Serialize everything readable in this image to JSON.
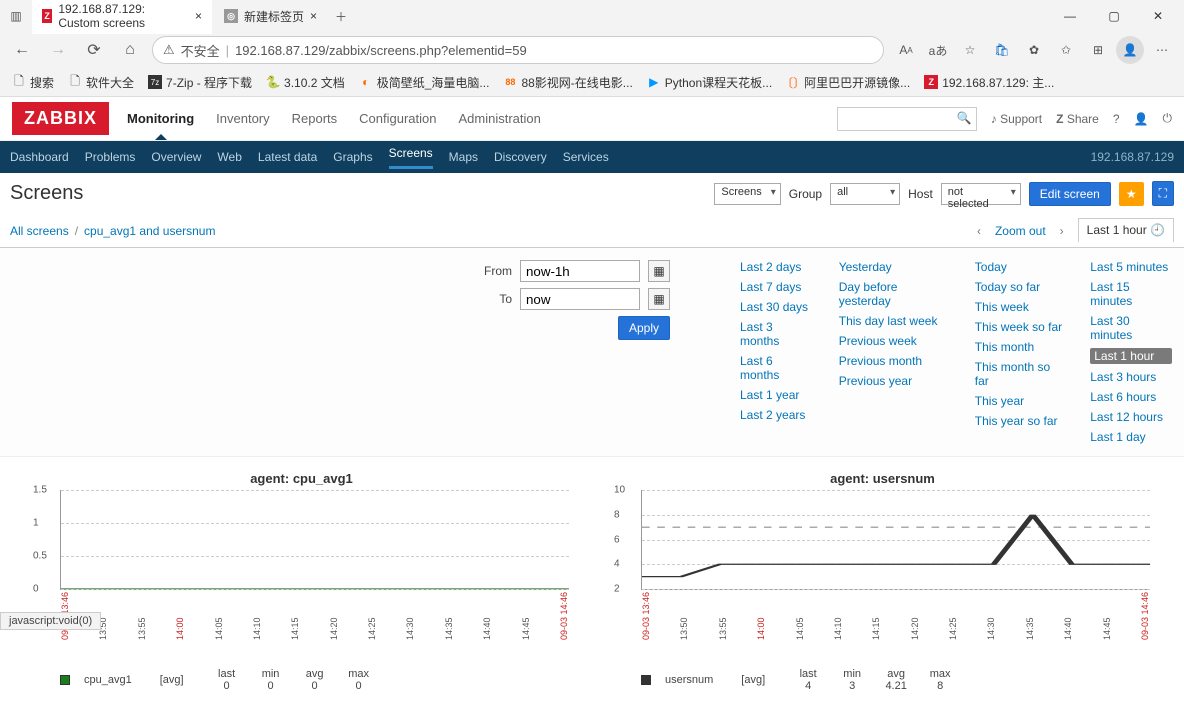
{
  "browser": {
    "tabs": [
      {
        "favicon": "Z",
        "title": "192.168.87.129: Custom screens"
      },
      {
        "favicon": "",
        "title": "新建标签页"
      }
    ],
    "url_insecure": "不安全",
    "url": "192.168.87.129/zabbix/screens.php?elementid=59",
    "bookmarks": [
      "搜索",
      "软件大全",
      "7-Zip - 程序下载",
      "3.10.2 文档",
      "极简壁纸_海量电脑...",
      "88影视网-在线电影...",
      "Python课程天花板...",
      "阿里巴巴开源镜像...",
      "192.168.87.129: 主..."
    ]
  },
  "zabbix": {
    "logo": "ZABBIX",
    "topmenu": [
      "Monitoring",
      "Inventory",
      "Reports",
      "Configuration",
      "Administration"
    ],
    "topmenu_selected": "Monitoring",
    "support": "Support",
    "share": "Share",
    "submenu": [
      "Dashboard",
      "Problems",
      "Overview",
      "Web",
      "Latest data",
      "Graphs",
      "Screens",
      "Maps",
      "Discovery",
      "Services"
    ],
    "submenu_selected": "Screens",
    "host_ip": "192.168.87.129"
  },
  "page": {
    "title": "Screens",
    "select_screens": "Screens",
    "group_label": "Group",
    "group_value": "all",
    "host_label": "Host",
    "host_value": "not selected",
    "edit_btn": "Edit screen"
  },
  "breadcrumb": {
    "all": "All screens",
    "current": "cpu_avg1 and usersnum",
    "zoom": "Zoom out",
    "period": "Last 1 hour"
  },
  "filter": {
    "from_label": "From",
    "from_value": "now-1h",
    "to_label": "To",
    "to_value": "now",
    "apply": "Apply",
    "presets_col1": [
      "Last 2 days",
      "Last 7 days",
      "Last 30 days",
      "Last 3 months",
      "Last 6 months",
      "Last 1 year",
      "Last 2 years"
    ],
    "presets_col2": [
      "Yesterday",
      "Day before yesterday",
      "This day last week",
      "Previous week",
      "Previous month",
      "Previous year"
    ],
    "presets_col3": [
      "Today",
      "Today so far",
      "This week",
      "This week so far",
      "This month",
      "This month so far",
      "This year",
      "This year so far"
    ],
    "presets_col4": [
      "Last 5 minutes",
      "Last 15 minutes",
      "Last 30 minutes",
      "Last 1 hour",
      "Last 3 hours",
      "Last 6 hours",
      "Last 12 hours",
      "Last 1 day"
    ],
    "selected": "Last 1 hour"
  },
  "chart_data": [
    {
      "type": "line",
      "title": "agent: cpu_avg1",
      "yticks": [
        0,
        0.5,
        1.0,
        1.5
      ],
      "xticks": [
        "09-03 13:46",
        "13:50",
        "13:55",
        "14:00",
        "14:05",
        "14:10",
        "14:15",
        "14:20",
        "14:25",
        "14:30",
        "14:35",
        "14:40",
        "14:45",
        "09-03 14:46"
      ],
      "series": [
        {
          "name": "cpu_avg1",
          "color": "#1b7e1b",
          "values": [
            0,
            0,
            0,
            0,
            0,
            0,
            0,
            0,
            0,
            0,
            0,
            0,
            0,
            0
          ]
        }
      ],
      "legend": {
        "label": "cpu_avg1",
        "avg_label": "[avg]",
        "stats": {
          "last": "0",
          "min": "0",
          "avg": "0",
          "max": "0"
        }
      }
    },
    {
      "type": "line",
      "title": "agent: usersnum",
      "yticks": [
        2,
        4,
        6,
        8,
        10
      ],
      "xticks": [
        "09-03 13:46",
        "13:50",
        "13:55",
        "14:00",
        "14:05",
        "14:10",
        "14:15",
        "14:20",
        "14:25",
        "14:30",
        "14:35",
        "14:40",
        "14:45",
        "09-03 14:46"
      ],
      "series": [
        {
          "name": "usersnum",
          "color": "#333",
          "values": [
            3,
            3,
            4,
            4,
            4,
            4,
            4,
            4,
            4,
            4,
            8,
            4,
            4,
            4
          ]
        }
      ],
      "trigger_line": 7,
      "legend": {
        "label": "usersnum",
        "avg_label": "[avg]",
        "stats": {
          "last": "4",
          "min": "3",
          "avg": "4.21",
          "max": "8"
        }
      }
    }
  ],
  "statusbar": "javascript:void(0)"
}
